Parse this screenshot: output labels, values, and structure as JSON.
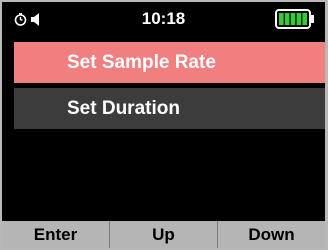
{
  "status_bar": {
    "time": "10:18",
    "timer_icon": "clock-icon",
    "sound_icon": "speaker-icon",
    "battery_icon": "battery-full-icon",
    "battery_level": 1.0,
    "battery_color": "#33cc33"
  },
  "menu": {
    "items": [
      {
        "label": "Set Sample Rate",
        "selected": true
      },
      {
        "label": "Set Duration",
        "selected": false
      }
    ],
    "selected_color": "#f17f7f",
    "item_color": "#3c3c3c"
  },
  "softkeys": {
    "enter_label": "Enter",
    "up_label": "Up",
    "down_label": "Down"
  }
}
